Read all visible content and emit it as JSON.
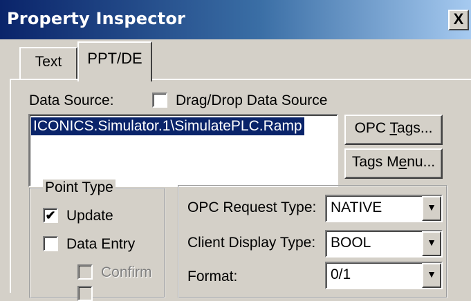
{
  "window": {
    "title": "Property Inspector",
    "close_glyph": "X"
  },
  "tabs": [
    {
      "label": "Text",
      "active": false
    },
    {
      "label": "PPT/DE",
      "active": true
    }
  ],
  "data_source": {
    "label": "Data Source:",
    "dragdrop_label": "Drag/Drop Data Source",
    "dragdrop_checked": false,
    "value": "ICONICS.Simulator.1\\SimulatePLC.Ramp"
  },
  "buttons": {
    "opc_tags_pre": "OPC ",
    "opc_tags_mnemonic": "T",
    "opc_tags_post": "ags...",
    "tags_menu_pre": "Tags M",
    "tags_menu_mnemonic": "e",
    "tags_menu_post": "nu..."
  },
  "point_type": {
    "legend": "Point Type",
    "update_label": "Update",
    "update_checked": true,
    "data_entry_label": "Data Entry",
    "data_entry_checked": false,
    "confirm_label": "Confirm",
    "confirm_disabled": true,
    "check_glyph": "✔"
  },
  "opc": {
    "request_type_label": "OPC Request Type:",
    "request_type_value": "NATIVE",
    "client_display_label": "Client Display Type:",
    "client_display_value": "BOOL",
    "format_label": "Format:",
    "format_value": "0/1",
    "arrow_glyph": "▼"
  },
  "colors": {
    "title_bar": "#0a246a",
    "selection": "#0a246a",
    "face": "#d4d0c8"
  }
}
